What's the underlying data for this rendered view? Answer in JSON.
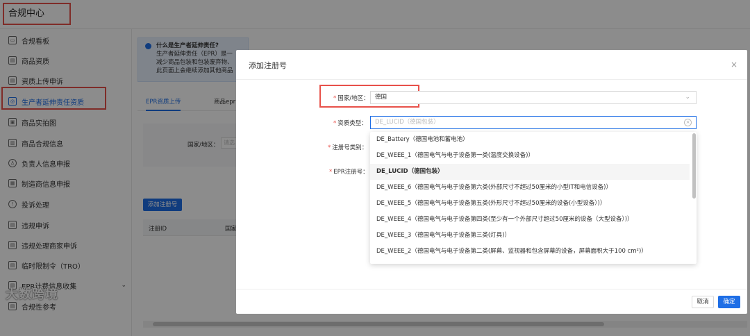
{
  "header": {
    "title": "合规中心"
  },
  "sidebar": {
    "items": [
      {
        "label": "合规看板",
        "icon": "dashboard-icon"
      },
      {
        "label": "商品资质",
        "icon": "product-icon"
      },
      {
        "label": "资质上传申诉",
        "icon": "upload-icon"
      },
      {
        "label": "生产者延伸责任资质",
        "icon": "certificate-icon"
      },
      {
        "label": "商品实拍图",
        "icon": "photo-icon"
      },
      {
        "label": "商品合规信息",
        "icon": "info-icon"
      },
      {
        "label": "负责人信息申报",
        "icon": "user-icon"
      },
      {
        "label": "制造商信息申报",
        "icon": "factory-icon"
      },
      {
        "label": "投诉处理",
        "icon": "complaint-icon"
      },
      {
        "label": "违规申诉",
        "icon": "appeal-icon"
      },
      {
        "label": "违规处理商家申诉",
        "icon": "merchant-icon"
      },
      {
        "label": "临时限制令（TRO）",
        "icon": "restriction-icon"
      },
      {
        "label": "EPR计费信息收集",
        "icon": "billing-icon"
      },
      {
        "label": "合规性参考",
        "icon": "reference-icon"
      }
    ],
    "watermark": "大数跨境"
  },
  "background": {
    "info_title": "什么是生产者延伸责任?",
    "info_line1": "生产者延伸责任（EPR）是一",
    "info_line2": "减少商品包装和包装废弃物、",
    "info_line3": "此页面上会继续添加其他商品",
    "tab_active": "EPR资质上传",
    "tab_other": "商品epr",
    "filter_label": "国家/地区：",
    "filter_placeholder": "请选",
    "add_button": "添加注册号",
    "col_id": "注册ID",
    "col_country": "国家"
  },
  "modal": {
    "title": "添加注册号",
    "close": "×",
    "country_label": "国家/地区：",
    "country_value": "德国",
    "type_label": "资质类型：",
    "type_placeholder": "DE_LUCID（德国包装）",
    "regtype_label": "注册号类别：",
    "epr_label": "EPR注册号：",
    "cancel": "取消",
    "ok": "确定"
  },
  "dropdown": {
    "options": [
      "DE_Battery（德国电池和蓄电池）",
      "DE_WEEE_1（德国电气与电子设备第一类(温度交换设备)）",
      "DE_LUCID（德国包装）",
      "DE_WEEE_6（德国电气与电子设备第六类(外部尺寸不超过50厘米的小型IT和电信设备)）",
      "DE_WEEE_5（德国电气与电子设备第五类(外形尺寸不超过50厘米的设备(小型设备）)）",
      "DE_WEEE_4（德国电气与电子设备第四类(至少有一个外部尺寸超过50厘米的设备（大型设备）)）",
      "DE_WEEE_3（德国电气与电子设备第三类(灯具)）",
      "DE_WEEE_2（德国电气与电子设备第二类(屏幕、监视器和包含屏幕的设备，屏幕面积大于100 cm²)）"
    ],
    "selected_index": 2
  }
}
